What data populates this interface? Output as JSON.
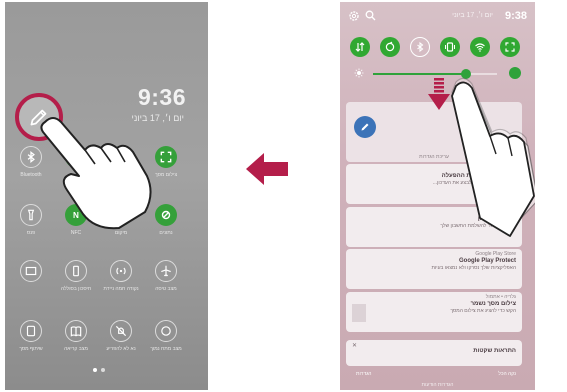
{
  "left_phone": {
    "time": "9:36",
    "date": "יום ו׳, 17 ביוני",
    "quick_settings": [
      {
        "icon": "bluetooth-icon",
        "label": "Bluetooth",
        "on": false
      },
      {
        "icon": "sync-icon",
        "label": "",
        "on": true
      },
      {
        "icon": "tilt-icon",
        "label": "",
        "on": true
      },
      {
        "icon": "screenshot-icon",
        "label": "צילום מסך",
        "on": true
      },
      {
        "icon": "flashlight-icon",
        "label": "פנס",
        "on": false
      },
      {
        "icon": "nfc-icon",
        "label": "NFC",
        "on": true
      },
      {
        "icon": "location-icon",
        "label": "מיקום",
        "on": true
      },
      {
        "icon": "data-icon",
        "label": "נתונים",
        "on": true
      },
      {
        "icon": "cast-icon",
        "label": "",
        "on": false
      },
      {
        "icon": "battery-saver-icon",
        "label": "חיסכון בסוללה",
        "on": false
      },
      {
        "icon": "hotspot-icon",
        "label": "נקודה חמה ניידת",
        "on": false
      },
      {
        "icon": "airplane-icon",
        "label": "מצב טיסה",
        "on": false
      },
      {
        "icon": "mirror-icon",
        "label": "שיתוף מסך",
        "on": false
      },
      {
        "icon": "book-icon",
        "label": "מצב קריאה",
        "on": false
      },
      {
        "icon": "no-disturb-icon",
        "label": "נא לא להפריע",
        "on": false
      },
      {
        "icon": "circle-icon",
        "label": "מצב מתח נמוך",
        "on": false
      }
    ]
  },
  "right_phone": {
    "time": "9:38",
    "date": "יום ו׳, 17 ביוני",
    "notifications": [
      {
        "header": "",
        "title": "",
        "body": "",
        "action": "עריכת הגדרות"
      },
      {
        "header": "עדכון מערכת",
        "title": "עדכון זמין למערכת ההפעלה",
        "body": "LG Bloom, ממליצים לבצע את העדכון..."
      },
      {
        "header": "הודעות",
        "title": "הגדרות חשבון",
        "body": "עוד שלב אחד להשלמת החשבון שלך"
      },
      {
        "header": "Google Play Store",
        "title": "Google Play Protect",
        "body": "האפליקציות שלך נסרקו ולא נמצאו בעיות"
      },
      {
        "header": "גלריה • אתמול",
        "title": "צילום מסך נשמר",
        "body": "הקש כדי להציג את צילום המסך"
      },
      {
        "header": "",
        "title": "התראות שקטות",
        "body": ""
      }
    ],
    "bottom": {
      "clear": "נקה הכל",
      "settings": "הגדרות",
      "footer": "הגדרות הודעות"
    }
  },
  "colors": {
    "accent_green": "#31a832",
    "highlight_ring": "#b41e4a",
    "arrow": "#b41e4a"
  }
}
